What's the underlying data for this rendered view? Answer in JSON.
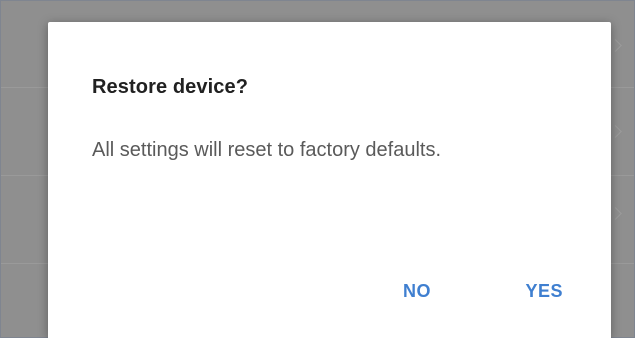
{
  "dialog": {
    "title": "Restore device?",
    "message": "All settings will reset to factory defaults.",
    "buttons": {
      "no": "NO",
      "yes": "YES"
    }
  },
  "colors": {
    "accent": "#3f7fd0",
    "title": "#212121",
    "message": "#5a5a5a",
    "scrim": "#8f8f8f"
  }
}
